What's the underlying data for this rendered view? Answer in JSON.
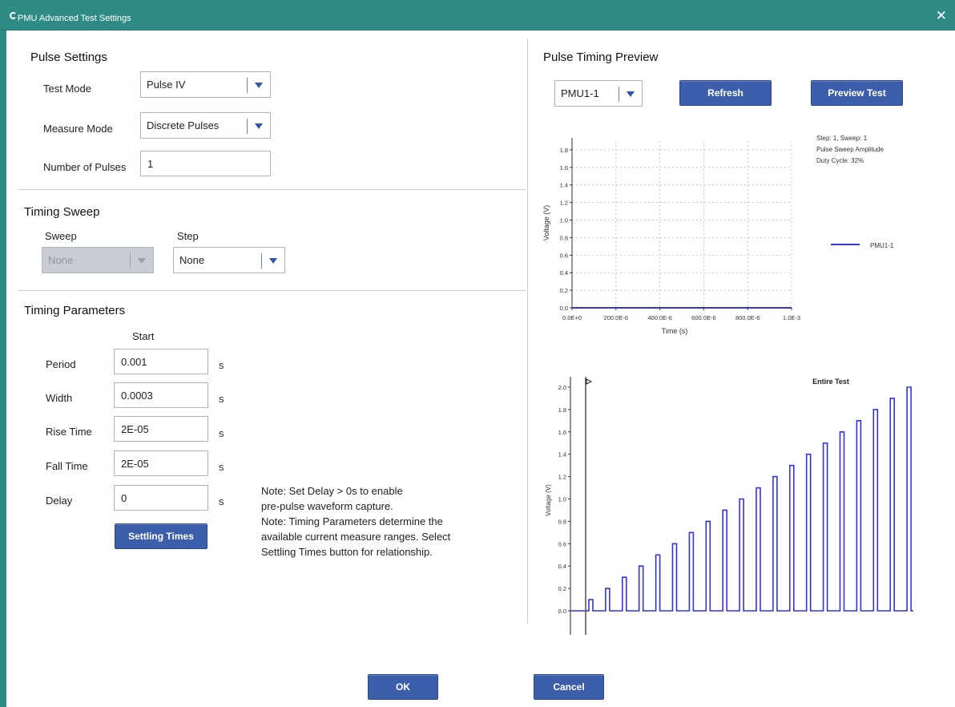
{
  "window": {
    "title": "PMU Advanced Test Settings",
    "close_glyph": "✕"
  },
  "pulse_settings": {
    "title": "Pulse Settings",
    "test_mode_label": "Test Mode",
    "test_mode_value": "Pulse IV",
    "measure_mode_label": "Measure Mode",
    "measure_mode_value": "Discrete Pulses",
    "num_pulses_label": "Number of Pulses",
    "num_pulses_value": "1"
  },
  "timing_sweep": {
    "title": "Timing Sweep",
    "sweep_label": "Sweep",
    "sweep_value": "None",
    "step_label": "Step",
    "step_value": "None"
  },
  "timing_params": {
    "title": "Timing Parameters",
    "start_header": "Start",
    "rows": [
      {
        "label": "Period",
        "value": "0.001",
        "unit": "s"
      },
      {
        "label": "Width",
        "value": "0.0003",
        "unit": "s"
      },
      {
        "label": "Rise Time",
        "value": "2E-05",
        "unit": "s"
      },
      {
        "label": "Fall Time",
        "value": "2E-05",
        "unit": "s"
      },
      {
        "label": "Delay",
        "value": "0",
        "unit": "s"
      }
    ],
    "settling_button": "Settling Times",
    "note_lines": [
      "Note: Set Delay > 0s to enable",
      "pre-pulse waveform capture.",
      "Note: Timing Parameters determine the",
      "available current measure ranges. Select",
      "Settling Times button for relationship."
    ]
  },
  "preview": {
    "title": "Pulse Timing Preview",
    "channel_value": "PMU1-1",
    "refresh_button": "Refresh",
    "preview_test_button": "Preview Test"
  },
  "footer": {
    "ok_button": "OK",
    "cancel_button": "Cancel"
  },
  "colors": {
    "accent": "#3d5fab",
    "titlebar": "#2f8b86",
    "trace": "#3333dd"
  },
  "chart_data": [
    {
      "type": "line",
      "info_lines": [
        "Step: 1, Sweep: 1",
        "Pulse Sweep Amplitude",
        "Duty Cycle: 32%"
      ],
      "xlabel": "Time (s)",
      "ylabel": "Voltage (V)",
      "x_ticks": [
        "0.0E+0",
        "200.0E-6",
        "400.0E-6",
        "600.0E-6",
        "800.0E-6",
        "1.0E-3"
      ],
      "y_ticks": [
        "0.0",
        "0.2",
        "0.4",
        "0.6",
        "0.8",
        "1.0",
        "1.2",
        "1.4",
        "1.6",
        "1.8"
      ],
      "xlim": [
        0,
        0.001
      ],
      "ylim": [
        0,
        1.9
      ],
      "grid": true,
      "legend_position": "right",
      "series": [
        {
          "name": "PMU1-1",
          "x": [
            0,
            0.001
          ],
          "y": [
            0,
            0
          ]
        }
      ]
    },
    {
      "type": "line",
      "title": "Entire Test",
      "ylabel": "Voltage (V)",
      "y_ticks": [
        "0.0",
        "0.2",
        "0.4",
        "0.6",
        "0.8",
        "1.0",
        "1.2",
        "1.4",
        "1.6",
        "1.8",
        "2.0"
      ],
      "ylim": [
        0,
        2.0
      ],
      "grid": false,
      "series": [
        {
          "pulse_amplitudes": [
            0.1,
            0.2,
            0.3,
            0.4,
            0.5,
            0.6,
            0.7,
            0.8,
            0.9,
            1.0,
            1.1,
            1.2,
            1.3,
            1.4,
            1.5,
            1.6,
            1.7,
            1.8,
            1.9,
            2.0
          ]
        }
      ]
    }
  ]
}
